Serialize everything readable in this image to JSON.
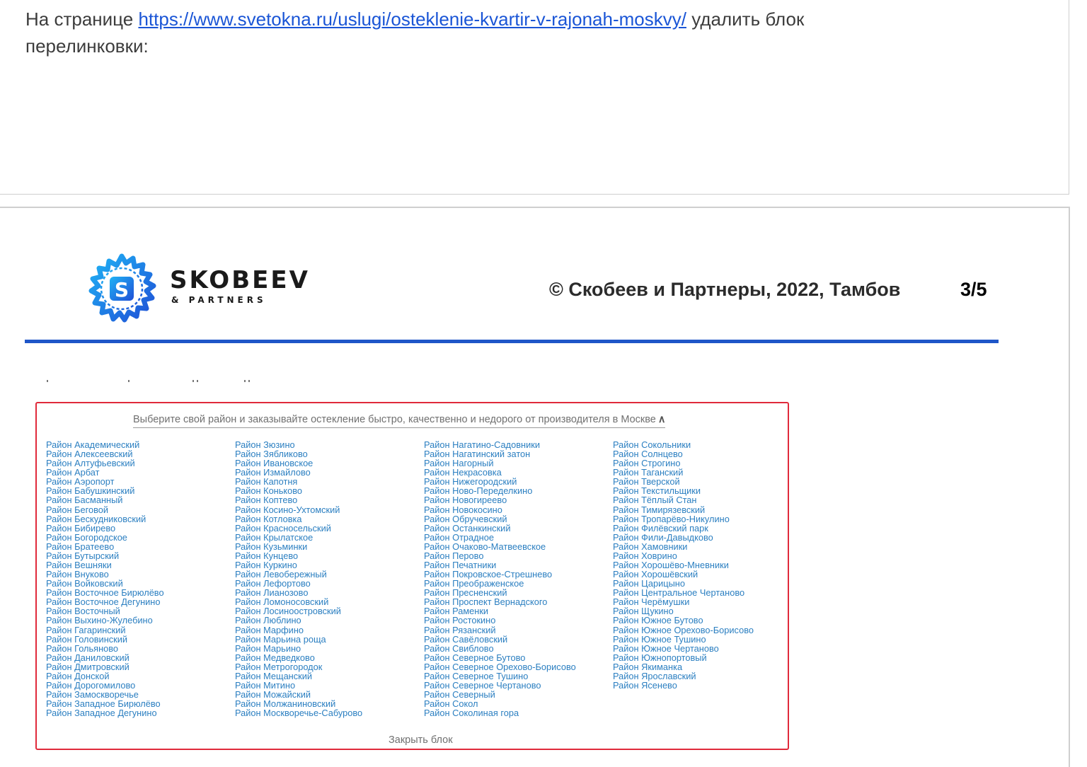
{
  "instruction": {
    "prefix": "На странице ",
    "url": "https://www.svetokna.ru/uslugi/osteklenie-kvartir-v-rajonah-moskvy/",
    "suffix": " удалить блок перелинковки:"
  },
  "slide": {
    "brand_name": "SKOBEEV",
    "brand_sub": "& PARTNERS",
    "logo_letter": "S",
    "copyright": "© Скобеев и Партнеры, 2022, Тамбов",
    "page": "3/5",
    "accent_color": "#1f56c8"
  },
  "district_block": {
    "title": "Выберите свой район и заказывайте остекление быстро, качественно и недорого от производителя в Москве",
    "toggle_icon": "chevron-up-icon",
    "close_label": "Закрыть блок",
    "frame_color": "#e02a3b",
    "link_color": "#2b7fc1",
    "columns": [
      [
        "Район Академический",
        "Район Алексеевский",
        "Район Алтуфьевский",
        "Район Арбат",
        "Район Аэропорт",
        "Район Бабушкинский",
        "Район Басманный",
        "Район Беговой",
        "Район Бескудниковский",
        "Район Бибирево",
        "Район Богородское",
        "Район Братеево",
        "Район Бутырский",
        "Район Вешняки",
        "Район Внуково",
        "Район Войковский",
        "Район Восточное Бирюлёво",
        "Район Восточное Дегунино",
        "Район Восточный",
        "Район Выхино-Жулебино",
        "Район Гагаринский",
        "Район Головинский",
        "Район Гольяново",
        "Район Даниловский",
        "Район Дмитровский",
        "Район Донской",
        "Район Дорогомилово",
        "Район Замоскворечье",
        "Район Западное Бирюлёво",
        "Район Западное Дегунино"
      ],
      [
        "Район Зюзино",
        "Район Зябликово",
        "Район Ивановское",
        "Район Измайлово",
        "Район Капотня",
        "Район Коньково",
        "Район Коптево",
        "Район Косино-Ухтомский",
        "Район Котловка",
        "Район Красносельский",
        "Район Крылатское",
        "Район Кузьминки",
        "Район Кунцево",
        "Район Куркино",
        "Район Левобережный",
        "Район Лефортово",
        "Район Лианозово",
        "Район Ломоносовский",
        "Район Лосиноостровский",
        "Район Люблино",
        "Район Марфино",
        "Район Марьина роща",
        "Район Марьино",
        "Район Медведково",
        "Район Метрогородок",
        "Район Мещанский",
        "Район Митино",
        "Район Можайский",
        "Район Молжаниновский",
        "Район Москворечье-Сабурово"
      ],
      [
        "Район Нагатино-Садовники",
        "Район Нагатинский затон",
        "Район Нагорный",
        "Район Некрасовка",
        "Район Нижегородский",
        "Район Ново-Переделкино",
        "Район Новогиреево",
        "Район Новокосино",
        "Район Обручевский",
        "Район Останкинский",
        "Район Отрадное",
        "Район Очаково-Матвеевское",
        "Район Перово",
        "Район Печатники",
        "Район Покровское-Стрешнево",
        "Район Преображенское",
        "Район Пресненский",
        "Район Проспект Вернадского",
        "Район Раменки",
        "Район Ростокино",
        "Район Рязанский",
        "Район Савёловский",
        "Район Свиблово",
        "Район Северное Бутово",
        "Район Северное Орехово-Борисово",
        "Район Северное Тушино",
        "Район Северное Чертаново",
        "Район Северный",
        "Район Сокол",
        "Район Соколиная гора"
      ],
      [
        "Район Сокольники",
        "Район Солнцево",
        "Район Строгино",
        "Район Таганский",
        "Район Тверской",
        "Район Текстильщики",
        "Район Тёплый Стан",
        "Район Тимирязевский",
        "Район Тропарёво-Никулино",
        "Район Филёвский парк",
        "Район Фили-Давыдково",
        "Район Хамовники",
        "Район Ховрино",
        "Район Хорошёво-Мневники",
        "Район Хорошёвский",
        "Район Царицыно",
        "Район Центральное Чертаново",
        "Район Черёмушки",
        "Район Щукино",
        "Район Южное Бутово",
        "Район Южное Орехово-Борисово",
        "Район Южное Тушино",
        "Район Южное Чертаново",
        "Район Южнопортовый",
        "Район Якиманка",
        "Район Ярославский",
        "Район Ясенево"
      ]
    ]
  }
}
